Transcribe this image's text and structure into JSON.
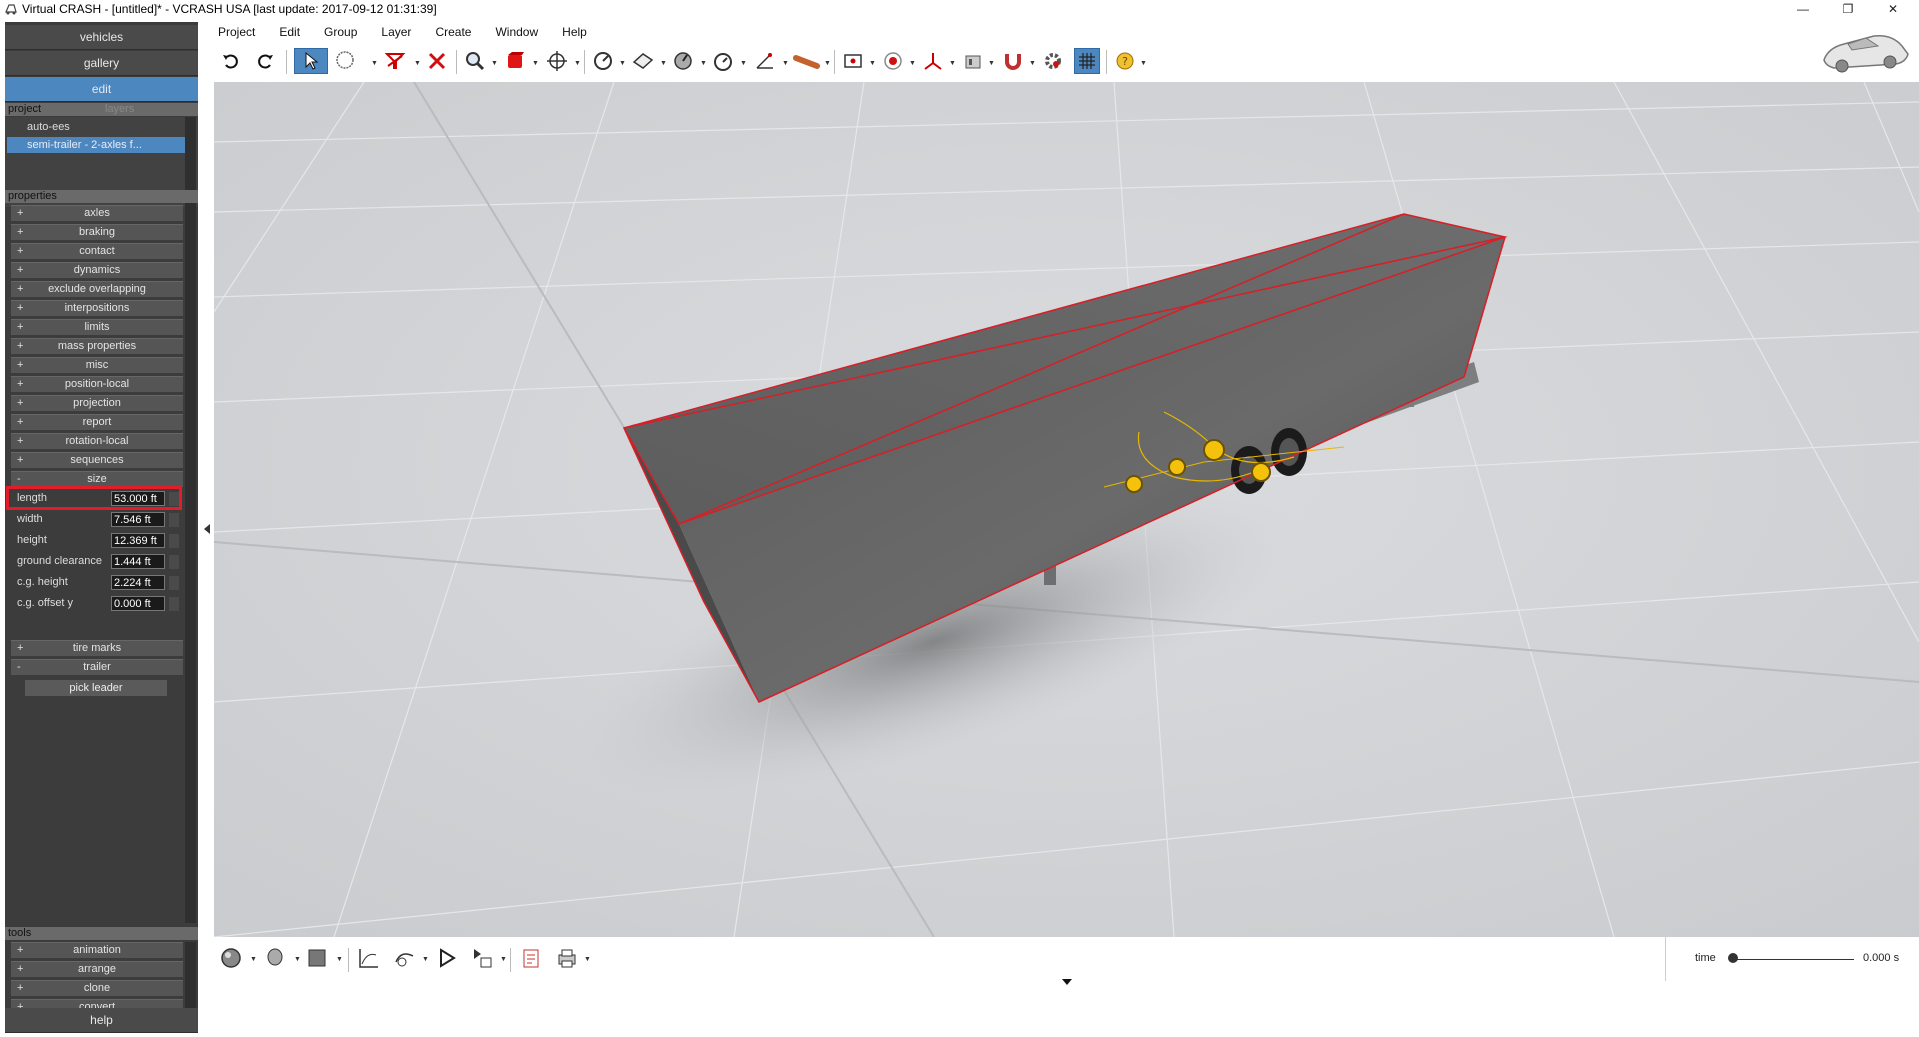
{
  "window": {
    "title": "Virtual CRASH - [untitled]* - VCRASH USA [last update: 2017-09-12 01:31:39]",
    "minimize": "—",
    "restore": "❐",
    "close": "✕"
  },
  "nav": {
    "vehicles": "vehicles",
    "gallery": "gallery",
    "edit": "edit",
    "help": "help"
  },
  "project_tabs": {
    "project": "project",
    "layers": "layers"
  },
  "project_items": [
    "auto-ees",
    "semi-trailer - 2-axles f..."
  ],
  "properties": {
    "header": "properties",
    "groups": [
      {
        "sign": "+",
        "label": "axles"
      },
      {
        "sign": "+",
        "label": "braking"
      },
      {
        "sign": "+",
        "label": "contact"
      },
      {
        "sign": "+",
        "label": "dynamics"
      },
      {
        "sign": "+",
        "label": "exclude overlapping"
      },
      {
        "sign": "+",
        "label": "interpositions"
      },
      {
        "sign": "+",
        "label": "limits"
      },
      {
        "sign": "+",
        "label": "mass properties"
      },
      {
        "sign": "+",
        "label": "misc"
      },
      {
        "sign": "+",
        "label": "position-local"
      },
      {
        "sign": "+",
        "label": "projection"
      },
      {
        "sign": "+",
        "label": "report"
      },
      {
        "sign": "+",
        "label": "rotation-local"
      },
      {
        "sign": "+",
        "label": "sequences"
      },
      {
        "sign": "-",
        "label": "size"
      }
    ],
    "size_fields": [
      {
        "label": "length",
        "value": "53.000 ft"
      },
      {
        "label": "width",
        "value": "7.546 ft"
      },
      {
        "label": "height",
        "value": "12.369 ft"
      },
      {
        "label": "ground clearance",
        "value": "1.444 ft"
      },
      {
        "label": "c.g. height",
        "value": "2.224 ft"
      },
      {
        "label": "c.g. offset y",
        "value": "0.000 ft"
      }
    ],
    "after_groups": [
      {
        "sign": "+",
        "label": "tire marks"
      },
      {
        "sign": "-",
        "label": "trailer"
      }
    ],
    "pick_leader": "pick leader"
  },
  "tools": {
    "header": "tools",
    "items": [
      {
        "sign": "+",
        "label": "animation"
      },
      {
        "sign": "+",
        "label": "arrange"
      },
      {
        "sign": "+",
        "label": "clone"
      },
      {
        "sign": "+",
        "label": "convert"
      }
    ]
  },
  "menu": [
    "Project",
    "Edit",
    "Group",
    "Layer",
    "Create",
    "Window",
    "Help"
  ],
  "time": {
    "label": "time",
    "value": "0.000 s"
  },
  "colors": {
    "accent": "#4d87c0",
    "highlight": "#e21d2a",
    "panel": "#3c3c3c",
    "viewport": "#d2d4d6"
  }
}
